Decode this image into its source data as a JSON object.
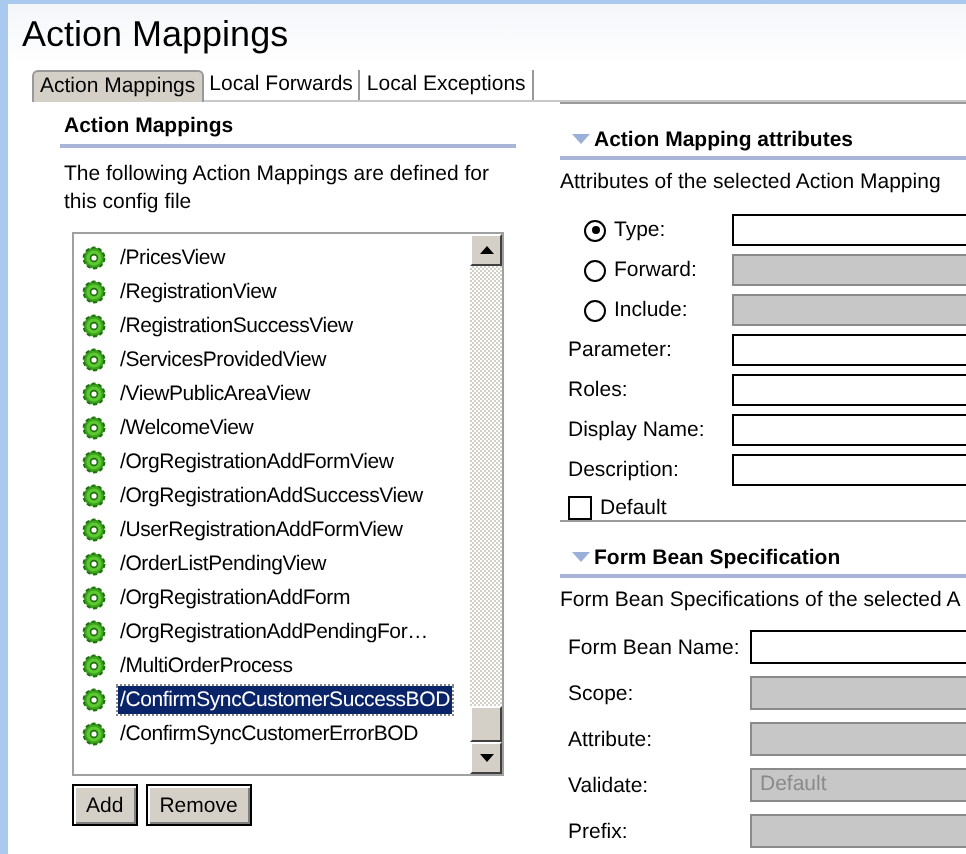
{
  "title": "Action Mappings",
  "tabs": [
    {
      "label": "Action Mappings",
      "selected": true
    },
    {
      "label": "Local Forwards",
      "selected": false
    },
    {
      "label": "Local Exceptions",
      "selected": false
    }
  ],
  "mappings_section": {
    "heading": "Action Mappings",
    "description": "The following Action Mappings are defined for this config file",
    "items": [
      {
        "label": "/PricesView",
        "selected": false
      },
      {
        "label": "/RegistrationView",
        "selected": false
      },
      {
        "label": "/RegistrationSuccessView",
        "selected": false
      },
      {
        "label": "/ServicesProvidedView",
        "selected": false
      },
      {
        "label": "/ViewPublicAreaView",
        "selected": false
      },
      {
        "label": "/WelcomeView",
        "selected": false
      },
      {
        "label": "/OrgRegistrationAddFormView",
        "selected": false
      },
      {
        "label": "/OrgRegistrationAddSuccessView",
        "selected": false
      },
      {
        "label": "/UserRegistrationAddFormView",
        "selected": false
      },
      {
        "label": "/OrderListPendingView",
        "selected": false
      },
      {
        "label": "/OrgRegistrationAddForm",
        "selected": false
      },
      {
        "label": "/OrgRegistrationAddPendingFor…",
        "selected": false
      },
      {
        "label": "/MultiOrderProcess",
        "selected": false
      },
      {
        "label": "/ConfirmSyncCustomerSuccessBOD",
        "selected": true
      },
      {
        "label": "/ConfirmSyncCustomerErrorBOD",
        "selected": false
      }
    ],
    "buttons": [
      "Add",
      "Remove"
    ]
  },
  "attributes_section": {
    "heading": "Action Mapping attributes",
    "description": "Attributes of the selected Action Mapping",
    "type_options": [
      {
        "label": "Type:",
        "selected": true,
        "disabled": false
      },
      {
        "label": "Forward:",
        "selected": false,
        "disabled": true
      },
      {
        "label": "Include:",
        "selected": false,
        "disabled": true
      }
    ],
    "fields": [
      {
        "label": "Parameter:",
        "disabled": false
      },
      {
        "label": "Roles:",
        "disabled": false
      },
      {
        "label": "Display Name:",
        "disabled": false
      },
      {
        "label": "Description:",
        "disabled": false
      }
    ],
    "default_checkbox": {
      "label": "Default",
      "checked": false
    }
  },
  "form_bean_section": {
    "heading": "Form Bean Specification",
    "description": "Form Bean Specifications of the selected A",
    "fields": [
      {
        "label": "Form Bean Name:",
        "disabled": false
      },
      {
        "label": "Scope:",
        "disabled": true
      },
      {
        "label": "Attribute:",
        "disabled": true
      },
      {
        "label": "Validate:",
        "disabled": true,
        "value": "Default"
      },
      {
        "label": "Prefix:",
        "disabled": true
      }
    ]
  }
}
